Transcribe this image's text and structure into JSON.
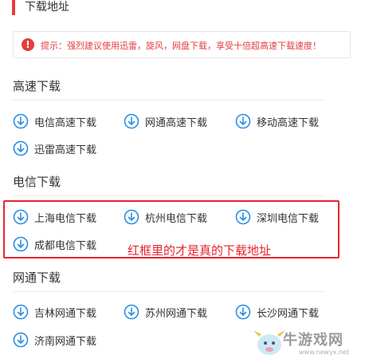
{
  "header": {
    "title": "下载地址"
  },
  "tip": {
    "label": "提示：",
    "text": "强烈建议使用迅雷，旋风，网盘下载，享受十倍超高速下载速度！"
  },
  "sections": {
    "fast": {
      "title": "高速下载",
      "items": [
        "电信高速下载",
        "网通高速下载",
        "移动高速下载",
        "迅雷高速下载"
      ]
    },
    "telecom": {
      "title": "电信下载",
      "items": [
        "上海电信下载",
        "杭州电信下载",
        "深圳电信下载",
        "成都电信下载"
      ]
    },
    "netcom": {
      "title": "网通下载",
      "items": [
        "吉林网通下载",
        "苏州网通下载",
        "长沙网通下载",
        "济南网通下载"
      ]
    }
  },
  "annotation": "红框里的才是真的下载地址",
  "watermark": {
    "text": "牛游戏网",
    "url": "www.newyx.net"
  },
  "colors": {
    "accent": "#e83b3b",
    "icon": "#2a8ee6",
    "frame": "#e8242d"
  },
  "icons": {
    "tip": "exclamation-icon",
    "download": "download-arrow-icon"
  }
}
